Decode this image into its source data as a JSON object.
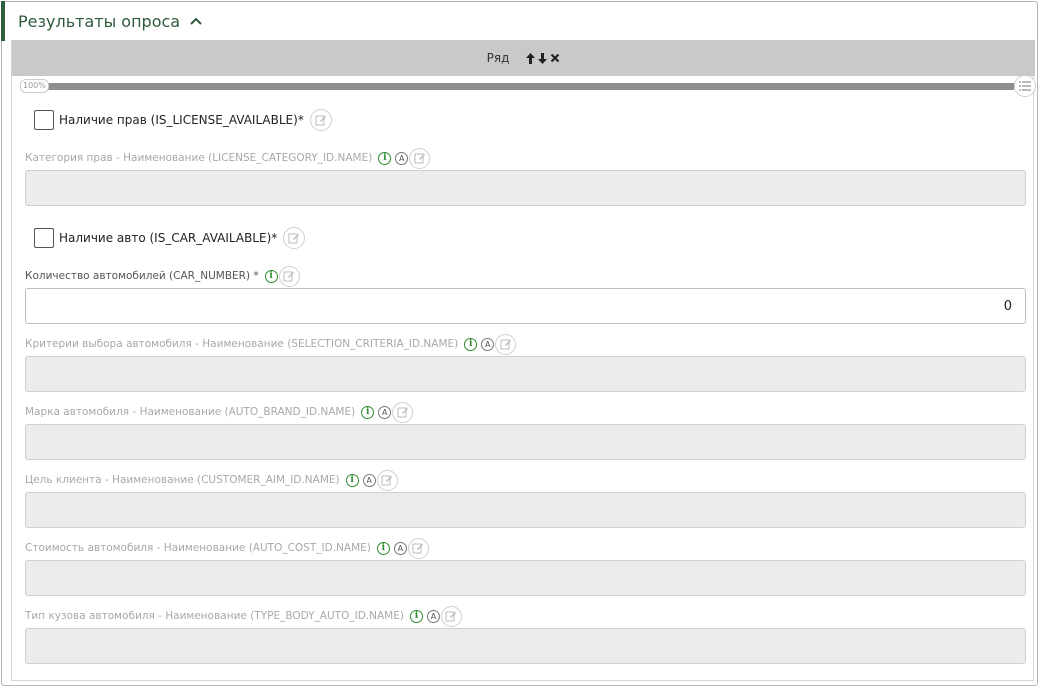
{
  "panel": {
    "title": "Результаты опроса",
    "accent_color": "#2e5e3e",
    "collapse_icon": "chevron-up-icon"
  },
  "row": {
    "label": "Ряд",
    "controls": [
      "arrow-up-icon",
      "arrow-down-icon",
      "close-icon"
    ]
  },
  "progress": {
    "label": "100%",
    "value": 100
  },
  "fields": {
    "license_available": {
      "label": "Наличие прав (IS_LICENSE_AVAILABLE)*",
      "checked": false
    },
    "license_category": {
      "label": "Категория прав - Наименование (LICENSE_CATEGORY_ID.NAME)",
      "value": ""
    },
    "car_available": {
      "label": "Наличие авто (IS_CAR_AVAILABLE)*",
      "checked": false
    },
    "car_number": {
      "label": "Количество автомобилей (CAR_NUMBER) *",
      "value": "0"
    },
    "selection_criteria": {
      "label": "Критерии выбора автомобиля - Наименование (SELECTION_CRITERIA_ID.NAME)",
      "value": ""
    },
    "auto_brand": {
      "label": "Марка автомобиля - Наименование (AUTO_BRAND_ID.NAME)",
      "value": ""
    },
    "customer_aim": {
      "label": "Цель клиента - Наименование (CUSTOMER_AIM_ID.NAME)",
      "value": ""
    },
    "auto_cost": {
      "label": "Стоимость автомобиля - Наименование (AUTO_COST_ID.NAME)",
      "value": ""
    },
    "type_body": {
      "label": "Тип кузова автомобиля - Наименование (TYPE_BODY_AUTO_ID.NAME)",
      "value": ""
    }
  },
  "icons": {
    "info": "i",
    "auto": "A"
  }
}
